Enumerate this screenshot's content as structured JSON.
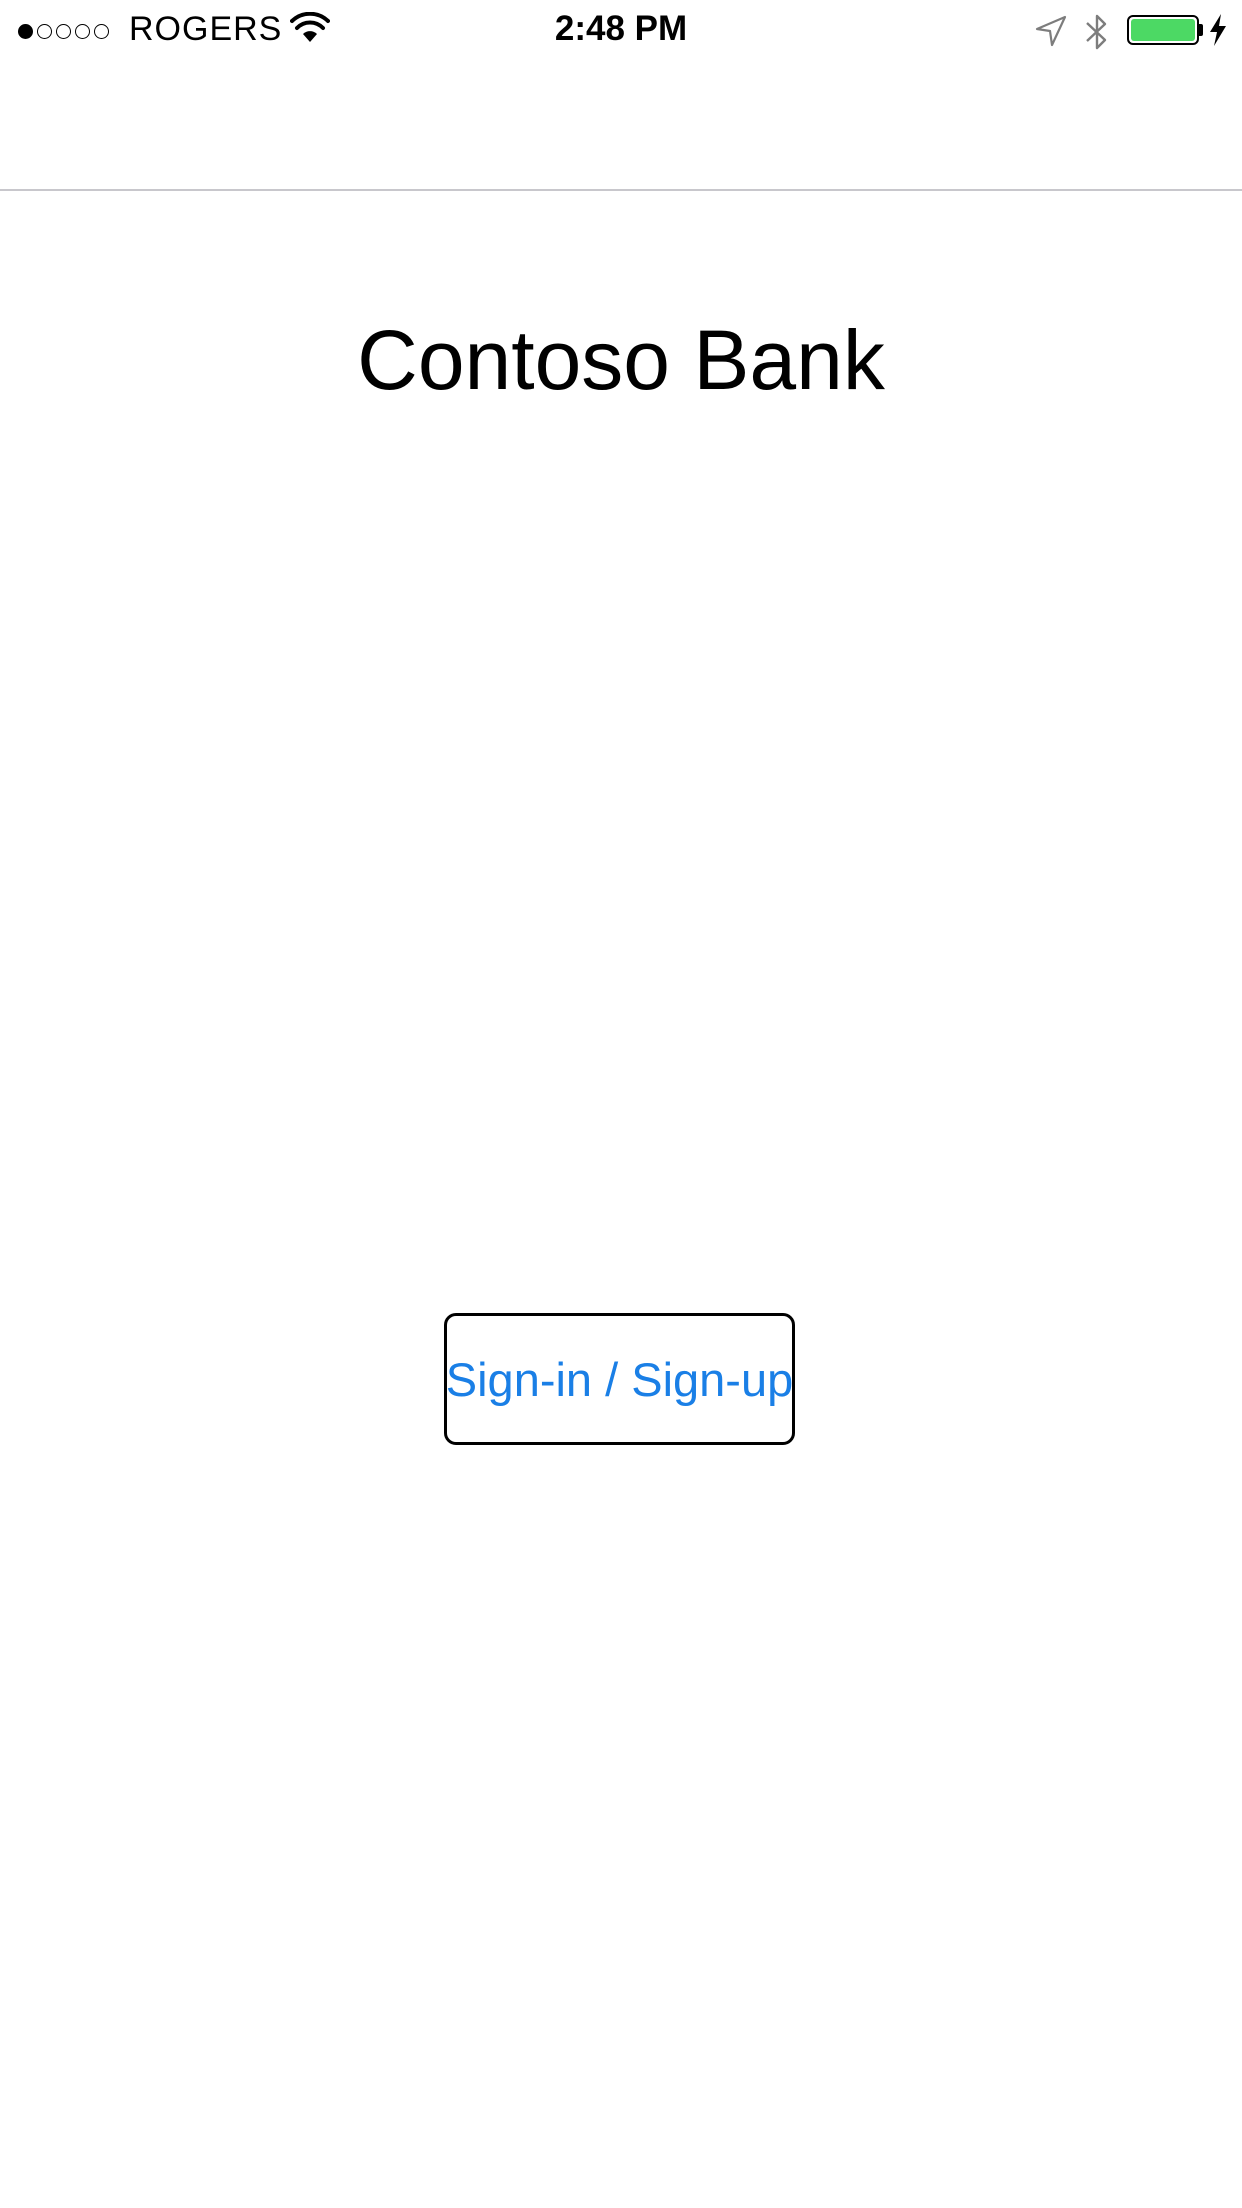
{
  "status_bar": {
    "signal_strength": 1,
    "signal_max": 5,
    "carrier": "ROGERS",
    "time": "2:48 PM",
    "wifi_icon": "wifi-icon",
    "location_icon": "location-arrow-icon",
    "bluetooth_icon": "bluetooth-icon",
    "battery_level": 1.0,
    "battery_color": "#4cd964",
    "charging": true
  },
  "main": {
    "title": "Contoso Bank",
    "signin_label": "Sign-in / Sign-up",
    "signin_color": "#1a7fe6"
  }
}
